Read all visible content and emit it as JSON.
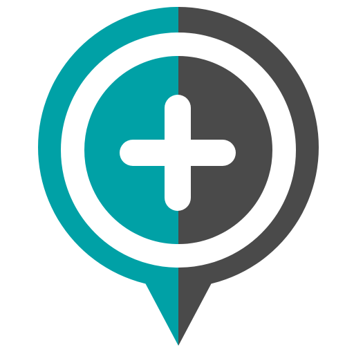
{
  "icon": {
    "name": "map-pin-plus-icon",
    "colors": {
      "left": "#00A1A6",
      "right": "#4A4A4A",
      "background": "#FFFFFF",
      "ring": "#FFFFFF",
      "plus": "#FFFFFF"
    }
  }
}
